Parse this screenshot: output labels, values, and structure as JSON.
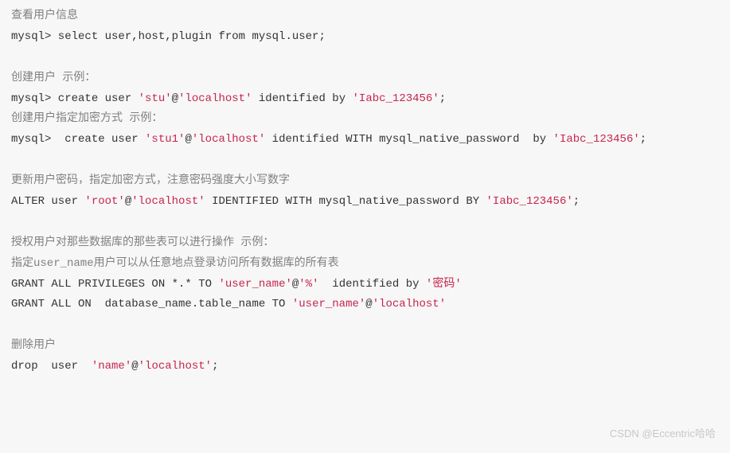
{
  "comments": {
    "c1": "查看用户信息",
    "c2": "创建用户 示例：",
    "c3": "创建用户指定加密方式 示例：",
    "c4": "更新用户密码，指定加密方式，注意密码强度大小写数字",
    "c5": "授权用户对那些数据库的那些表可以进行操作 示例：",
    "c6": "指定user_name用户可以从任意地点登录访问所有数据库的所有表",
    "c7": "删除用户"
  },
  "code": {
    "l1": "mysql> select user,host,plugin from mysql.user;",
    "l2a": "mysql> create user ",
    "l2b": " identified by ",
    "l2c": ";",
    "l3a": "mysql>  create user ",
    "l3b": " identified WITH mysql_native_password  by ",
    "l3c": ";",
    "l4a": "ALTER user ",
    "l4b": " IDENTIFIED WITH mysql_native_password BY ",
    "l4c": ";",
    "l5a": "GRANT ALL PRIVILEGES ON *.* TO ",
    "l5b": "  identified by ",
    "l6a": "GRANT ALL ON  database_name.table_name TO ",
    "l7a": "drop  user  ",
    "l7b": ";"
  },
  "strings": {
    "stu": "'stu'",
    "localhost": "'localhost'",
    "iabc": "'Iabc_123456'",
    "stu1": "'stu1'",
    "root": "'root'",
    "user_name": "'user_name'",
    "percent": "'%'",
    "password_cn": "'密码'",
    "name": "'name'"
  },
  "at": "@",
  "watermark": "CSDN @Eccentric哈哈"
}
